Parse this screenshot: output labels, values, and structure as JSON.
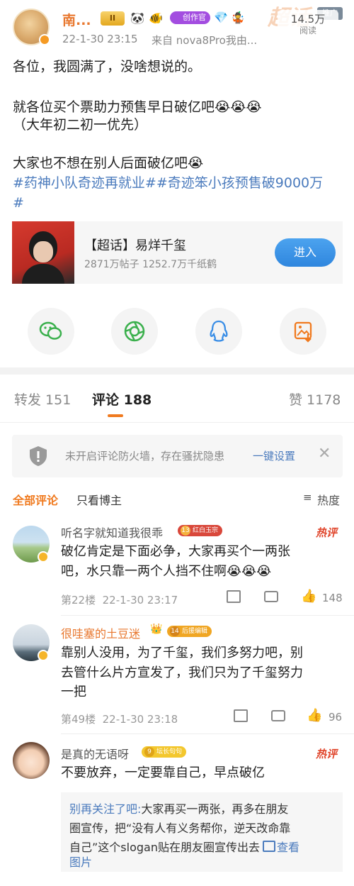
{
  "post": {
    "author": "南...",
    "level_badge": "II",
    "creator_badge": "创作官",
    "time": "22-1-30 23:15",
    "source": "来自 nova8Pro我由...",
    "views": "14.5万",
    "views_label": "阅读",
    "promote_tag": "推广",
    "corner_text": "超话",
    "lines": [
      "各位，我圆满了，没啥想说的。",
      "就各位买个票助力预售早日破亿吧😭😭😭",
      "（大年初二初一优先）",
      "大家也不想在别人后面破亿吧😭"
    ],
    "hashtags_line1": "#药神小队奇迹再就业##奇迹笨小孩预售破9000万",
    "hashtags_line2": "#"
  },
  "supertopic": {
    "title": "【超话】易烊千玺",
    "stats": "2871万帖子 1252.7万千纸鹤",
    "button": "进入"
  },
  "share": {
    "icons": [
      "wechat-icon",
      "moments-icon",
      "qq-icon",
      "save-image-icon"
    ]
  },
  "tabs": {
    "repost": "转发 151",
    "comment": "评论 188",
    "like": "赞 1178"
  },
  "notice": {
    "text": "未开启评论防火墙，存在骚扰隐患",
    "action": "一键设置"
  },
  "filters": {
    "all": "全部评论",
    "author_only": "只看博主",
    "sort": "热度"
  },
  "comments": [
    {
      "name": "听名字就知道我很乖",
      "badge_level": "13",
      "badge_text": "红白玉宗",
      "hot": "热评",
      "text1": "破亿肯定是下面必争，大家再买个一两张",
      "text2": "吧，水只靠一两个人挡不住啊😭😭😭",
      "meta": "第22楼  22-1-30 23:17",
      "likes": "148"
    },
    {
      "name": "很哇塞的土豆迷",
      "badge_level": "14",
      "badge_text": "后援编辑",
      "text1": "靠别人没用，为了千玺，我们多努力吧，别",
      "text2": "去管什么片方宣发了，我们只为了千玺努力",
      "text3": "一把",
      "meta": "第49楼  22-1-30 23:18",
      "likes": "96"
    },
    {
      "name": "是真的无语呀",
      "badge_level": "9",
      "badge_text": "坛长句句",
      "hot": "热评",
      "text1": "不要放弃，一定要靠自己，早点破亿",
      "reply_name": "别再关注了吧:",
      "reply1": "大家再买一两张，再多在朋友",
      "reply2": "圈宣传，把“没有人有义务帮你，逆天改命靠",
      "reply3": "自己”这个slogan贴在朋友圈宣传出去",
      "reply_link": "查看",
      "reply4": "图片"
    }
  ],
  "colors": {
    "accent_orange": "#f07a1f",
    "link_blue": "#4b7bbd",
    "enter_btn": "#3a8ee6",
    "hot_red": "#e0452b"
  }
}
